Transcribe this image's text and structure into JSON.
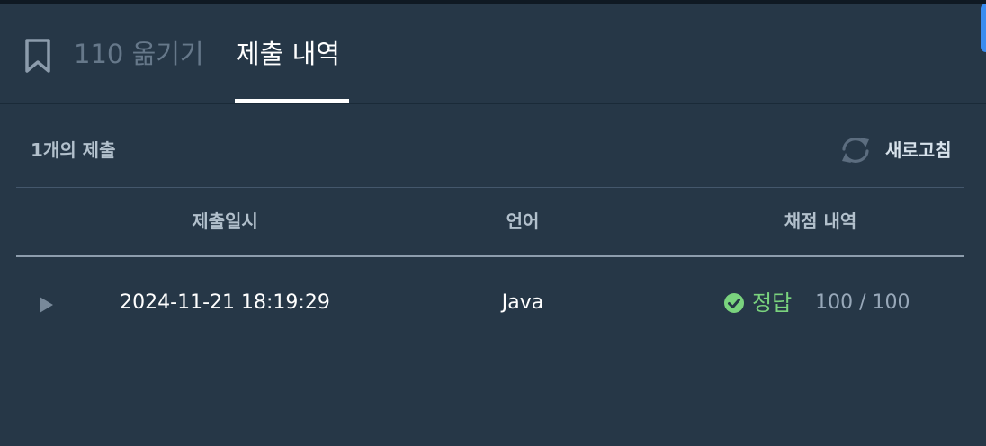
{
  "tabs": {
    "move_label": "110 옮기기",
    "history_label": "제출 내역"
  },
  "submissions": {
    "count_label": "1개의 제출",
    "refresh_label": "새로고침",
    "columns": {
      "date": "제출일시",
      "language": "언어",
      "result": "채점 내역"
    },
    "rows": [
      {
        "date": "2024-11-21 18:19:29",
        "language": "Java",
        "status": "정답",
        "score": "100 / 100"
      }
    ]
  },
  "colors": {
    "background": "#263747",
    "success": "#7ad37e",
    "muted": "#98a8b9"
  },
  "icons": {
    "bookmark": "bookmark-icon",
    "refresh": "refresh-icon",
    "expand": "play-icon",
    "success": "check-circle-icon"
  }
}
